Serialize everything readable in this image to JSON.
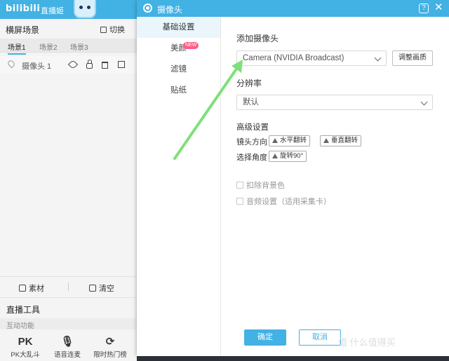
{
  "app": {
    "logo": "bilibili",
    "name": "直播姬"
  },
  "scenes": {
    "title": "横屏场景",
    "switch_label": "切换",
    "tabs": [
      {
        "label": "场景1",
        "active": true
      },
      {
        "label": "场景2",
        "active": false
      },
      {
        "label": "场景3",
        "active": false
      }
    ],
    "source_name": "摄像头 1"
  },
  "source_actions": {
    "material_label": "素材",
    "clear_label": "清空"
  },
  "tools": {
    "title": "直播工具",
    "section_label": "互动功能",
    "items": [
      {
        "label": "PK大乱斗",
        "glyph": "PK"
      },
      {
        "label": "语音连麦",
        "glyph": "mic"
      },
      {
        "label": "限时热门榜",
        "glyph": "hot"
      }
    ]
  },
  "dialog": {
    "title": "摄像头",
    "help": "?",
    "close": "✕",
    "nav": [
      {
        "label": "基础设置",
        "active": true
      },
      {
        "label": "美颜",
        "active": false,
        "badge": "NEW"
      },
      {
        "label": "滤镜",
        "active": false
      },
      {
        "label": "贴纸",
        "active": false
      }
    ],
    "add_camera_label": "添加摄像头",
    "camera_select_value": "Camera (NVIDIA Broadcast)",
    "adjust_button": "调整画质",
    "resolution_label": "分辨率",
    "resolution_value": "默认",
    "advanced_label": "高级设置",
    "mirror_label": "镜头方向",
    "flip_h": "水平翻转",
    "flip_v": "垂直翻转",
    "angle_label": "选择角度",
    "rotate": "旋转90°",
    "remove_bg": "扣除背景色",
    "audio_settings": "音频设置（适用采集卡）",
    "confirm": "确定",
    "cancel": "取消"
  },
  "watermark": "值 什么值得买",
  "colors": {
    "accent": "#42b1e3",
    "annotation_arrow": "#7ee07a",
    "badge": "#ff5b86"
  }
}
